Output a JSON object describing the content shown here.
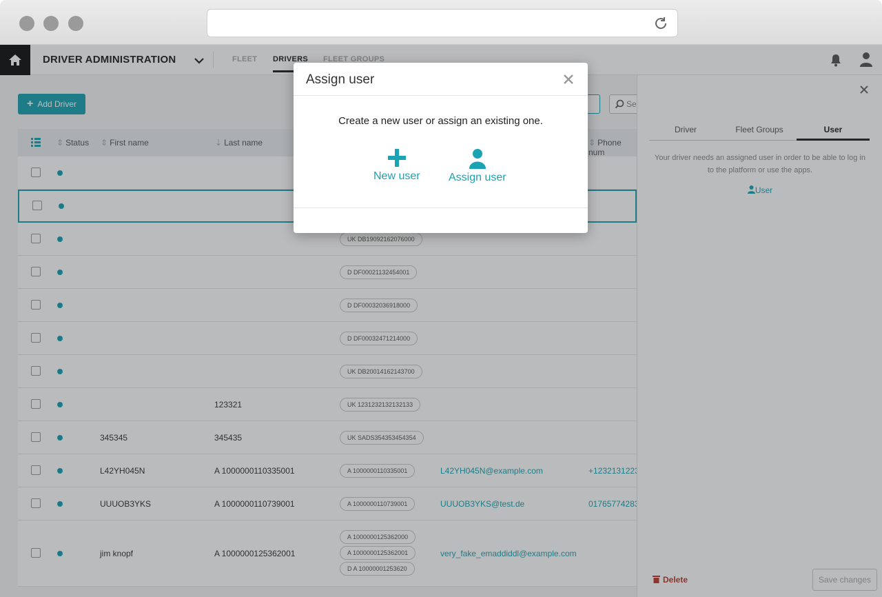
{
  "app": {
    "title": "DRIVER ADMINISTRATION",
    "nav_tabs": [
      {
        "label": "FLEET",
        "active": false
      },
      {
        "label": "DRIVERS",
        "active": true
      },
      {
        "label": "FLEET GROUPS",
        "active": false
      }
    ],
    "accent_color": "#1aa3b3"
  },
  "toolbar": {
    "add_driver_label": "Add Driver",
    "search_placeholder": "Se"
  },
  "table": {
    "columns": [
      "Status",
      "First name",
      "Last name",
      "Phone num"
    ],
    "rows": [
      {
        "first": "",
        "last": "",
        "ids": [],
        "email": "",
        "phone": ""
      },
      {
        "first": "",
        "last": "",
        "ids": [],
        "email": "",
        "phone": "",
        "selected": true
      },
      {
        "first": "",
        "last": "",
        "ids": [
          "UK DB19092162076000"
        ],
        "email": "",
        "phone": ""
      },
      {
        "first": "",
        "last": "",
        "ids": [
          "D DF00021132454001"
        ],
        "email": "",
        "phone": ""
      },
      {
        "first": "",
        "last": "",
        "ids": [
          "D DF00032036918000"
        ],
        "email": "",
        "phone": ""
      },
      {
        "first": "",
        "last": "",
        "ids": [
          "D DF00032471214000"
        ],
        "email": "",
        "phone": ""
      },
      {
        "first": "",
        "last": "",
        "ids": [
          "UK DB20014162143700"
        ],
        "email": "",
        "phone": ""
      },
      {
        "first": "",
        "last": "123321",
        "ids": [
          "UK 1231232132132133"
        ],
        "email": "",
        "phone": ""
      },
      {
        "first": "345345",
        "last": "345435",
        "ids": [
          "UK SADS354353454354"
        ],
        "email": "",
        "phone": ""
      },
      {
        "first": "L42YH045N",
        "last": "A 1000000110335001",
        "ids": [
          "A 1000000110335001"
        ],
        "email": "L42YH045N@example.com",
        "phone": "+1232131223"
      },
      {
        "first": "UUUOB3YKS",
        "last": "A 1000000110739001",
        "ids": [
          "A 1000000110739001"
        ],
        "email": "UUUOB3YKS@test.de",
        "phone": "01765774283"
      },
      {
        "first": "jim knopf",
        "last": "A 1000000125362001",
        "ids": [
          "A 1000000125362000",
          "A 1000000125362001",
          "D A 10000001253620"
        ],
        "email": "very_fake_emaddiddl@example.com",
        "phone": ""
      }
    ]
  },
  "side_panel": {
    "tabs": [
      "Driver",
      "Fleet Groups",
      "User"
    ],
    "active_tab": "User",
    "message": "Your driver needs an assigned user in order to be able to log in to the platform or use the apps.",
    "user_link": "User",
    "delete_label": "Delete",
    "save_label": "Save changes"
  },
  "modal": {
    "title": "Assign user",
    "message": "Create a new user or assign an existing one.",
    "new_user_label": "New user",
    "assign_user_label": "Assign user"
  }
}
